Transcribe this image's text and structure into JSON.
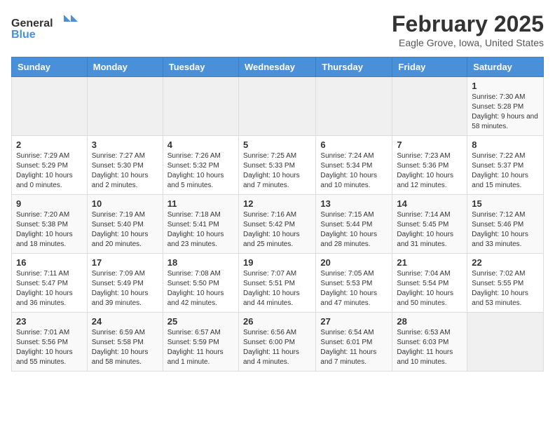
{
  "header": {
    "logo_general": "General",
    "logo_blue": "Blue",
    "title": "February 2025",
    "subtitle": "Eagle Grove, Iowa, United States"
  },
  "weekdays": [
    "Sunday",
    "Monday",
    "Tuesday",
    "Wednesday",
    "Thursday",
    "Friday",
    "Saturday"
  ],
  "weeks": [
    [
      {
        "day": "",
        "info": ""
      },
      {
        "day": "",
        "info": ""
      },
      {
        "day": "",
        "info": ""
      },
      {
        "day": "",
        "info": ""
      },
      {
        "day": "",
        "info": ""
      },
      {
        "day": "",
        "info": ""
      },
      {
        "day": "1",
        "info": "Sunrise: 7:30 AM\nSunset: 5:28 PM\nDaylight: 9 hours and 58 minutes."
      }
    ],
    [
      {
        "day": "2",
        "info": "Sunrise: 7:29 AM\nSunset: 5:29 PM\nDaylight: 10 hours and 0 minutes."
      },
      {
        "day": "3",
        "info": "Sunrise: 7:27 AM\nSunset: 5:30 PM\nDaylight: 10 hours and 2 minutes."
      },
      {
        "day": "4",
        "info": "Sunrise: 7:26 AM\nSunset: 5:32 PM\nDaylight: 10 hours and 5 minutes."
      },
      {
        "day": "5",
        "info": "Sunrise: 7:25 AM\nSunset: 5:33 PM\nDaylight: 10 hours and 7 minutes."
      },
      {
        "day": "6",
        "info": "Sunrise: 7:24 AM\nSunset: 5:34 PM\nDaylight: 10 hours and 10 minutes."
      },
      {
        "day": "7",
        "info": "Sunrise: 7:23 AM\nSunset: 5:36 PM\nDaylight: 10 hours and 12 minutes."
      },
      {
        "day": "8",
        "info": "Sunrise: 7:22 AM\nSunset: 5:37 PM\nDaylight: 10 hours and 15 minutes."
      }
    ],
    [
      {
        "day": "9",
        "info": "Sunrise: 7:20 AM\nSunset: 5:38 PM\nDaylight: 10 hours and 18 minutes."
      },
      {
        "day": "10",
        "info": "Sunrise: 7:19 AM\nSunset: 5:40 PM\nDaylight: 10 hours and 20 minutes."
      },
      {
        "day": "11",
        "info": "Sunrise: 7:18 AM\nSunset: 5:41 PM\nDaylight: 10 hours and 23 minutes."
      },
      {
        "day": "12",
        "info": "Sunrise: 7:16 AM\nSunset: 5:42 PM\nDaylight: 10 hours and 25 minutes."
      },
      {
        "day": "13",
        "info": "Sunrise: 7:15 AM\nSunset: 5:44 PM\nDaylight: 10 hours and 28 minutes."
      },
      {
        "day": "14",
        "info": "Sunrise: 7:14 AM\nSunset: 5:45 PM\nDaylight: 10 hours and 31 minutes."
      },
      {
        "day": "15",
        "info": "Sunrise: 7:12 AM\nSunset: 5:46 PM\nDaylight: 10 hours and 33 minutes."
      }
    ],
    [
      {
        "day": "16",
        "info": "Sunrise: 7:11 AM\nSunset: 5:47 PM\nDaylight: 10 hours and 36 minutes."
      },
      {
        "day": "17",
        "info": "Sunrise: 7:09 AM\nSunset: 5:49 PM\nDaylight: 10 hours and 39 minutes."
      },
      {
        "day": "18",
        "info": "Sunrise: 7:08 AM\nSunset: 5:50 PM\nDaylight: 10 hours and 42 minutes."
      },
      {
        "day": "19",
        "info": "Sunrise: 7:07 AM\nSunset: 5:51 PM\nDaylight: 10 hours and 44 minutes."
      },
      {
        "day": "20",
        "info": "Sunrise: 7:05 AM\nSunset: 5:53 PM\nDaylight: 10 hours and 47 minutes."
      },
      {
        "day": "21",
        "info": "Sunrise: 7:04 AM\nSunset: 5:54 PM\nDaylight: 10 hours and 50 minutes."
      },
      {
        "day": "22",
        "info": "Sunrise: 7:02 AM\nSunset: 5:55 PM\nDaylight: 10 hours and 53 minutes."
      }
    ],
    [
      {
        "day": "23",
        "info": "Sunrise: 7:01 AM\nSunset: 5:56 PM\nDaylight: 10 hours and 55 minutes."
      },
      {
        "day": "24",
        "info": "Sunrise: 6:59 AM\nSunset: 5:58 PM\nDaylight: 10 hours and 58 minutes."
      },
      {
        "day": "25",
        "info": "Sunrise: 6:57 AM\nSunset: 5:59 PM\nDaylight: 11 hours and 1 minute."
      },
      {
        "day": "26",
        "info": "Sunrise: 6:56 AM\nSunset: 6:00 PM\nDaylight: 11 hours and 4 minutes."
      },
      {
        "day": "27",
        "info": "Sunrise: 6:54 AM\nSunset: 6:01 PM\nDaylight: 11 hours and 7 minutes."
      },
      {
        "day": "28",
        "info": "Sunrise: 6:53 AM\nSunset: 6:03 PM\nDaylight: 11 hours and 10 minutes."
      },
      {
        "day": "",
        "info": ""
      }
    ]
  ]
}
